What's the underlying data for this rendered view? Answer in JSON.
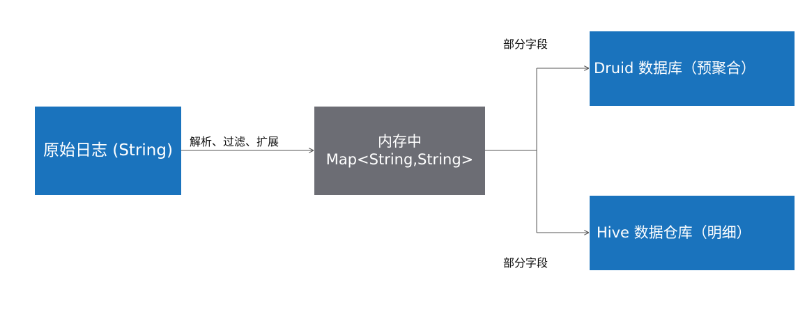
{
  "nodes": {
    "source": {
      "label": "原始日志 (String)",
      "color": "#1a73bd"
    },
    "memory": {
      "line1": "内存中",
      "line2": "Map<String,String>",
      "color": "#6c6d74"
    },
    "druid": {
      "label": "Druid 数据库（预聚合）",
      "color": "#1a73bd"
    },
    "hive": {
      "label": "Hive 数据仓库（明细）",
      "color": "#1a73bd"
    }
  },
  "edges": {
    "parse_label": "解析、过滤、扩展",
    "to_druid_label": "部分字段",
    "to_hive_label": "部分字段"
  },
  "line_color": "#555555"
}
